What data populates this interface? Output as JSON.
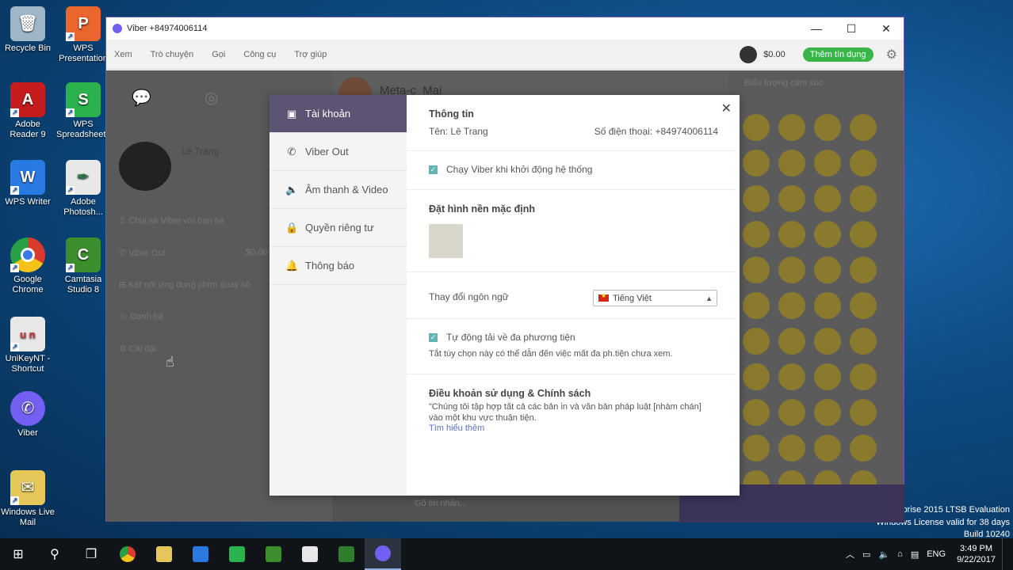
{
  "desktop": {
    "icons_left": [
      {
        "label": "Recycle Bin",
        "icon": "recycle-bin-icon",
        "color": "#9fb6c9"
      },
      {
        "label": "Adobe Reader 9",
        "icon": "adobe-reader-icon",
        "color": "#c51d1d"
      },
      {
        "label": "WPS Writer",
        "icon": "wps-writer-icon",
        "color": "#2a7ae4"
      },
      {
        "label": "Google Chrome",
        "icon": "chrome-icon",
        "color": "#e6b91c"
      },
      {
        "label": "UniKeyNT - Shortcut",
        "icon": "unikey-icon",
        "color": "#e8e8e8"
      },
      {
        "label": "Viber",
        "icon": "viber-icon",
        "color": "#7360f2"
      },
      {
        "label": "Windows Live Mail",
        "icon": "live-mail-icon",
        "color": "#e6c85a"
      }
    ],
    "icons_right": [
      {
        "label": "WPS Presentation",
        "icon": "wps-presentation-icon",
        "color": "#e9662c"
      },
      {
        "label": "WPS Spreadsheets",
        "icon": "wps-spreadsheets-icon",
        "color": "#2bb24c"
      },
      {
        "label": "Adobe Photosh...",
        "icon": "photoshop-feather-icon",
        "color": "#e8e8e8"
      },
      {
        "label": "Camtasia Studio 8",
        "icon": "camtasia-icon",
        "color": "#3d8f2e"
      }
    ],
    "watermark": [
      "rprise 2015 LTSB Evaluation",
      "Windows License valid for 38 days",
      "Build 10240"
    ]
  },
  "window": {
    "title": "Viber +84974006114",
    "menu": [
      "Xem",
      "Trò chuyện",
      "Gọi",
      "Công cụ",
      "Trợ giúp"
    ],
    "credit": "$0.00",
    "buy_credit": "Thêm tín dụng",
    "chat_contact": "Meta-c_Mai",
    "left_profile_name": "Lê Trang",
    "left_rows": [
      "Chia sẻ Viber với bạn bè",
      "Viber Out",
      "Kết nối ứng dụng phím quay số",
      "Danh bạ",
      "Cài đặt"
    ],
    "left_credit": "$0.00",
    "composer_placeholder": "Gõ tin nhắn...",
    "sticker_search": "Biểu tượng cảm xúc"
  },
  "settings": {
    "nav": [
      {
        "label": "Tài khoản",
        "icon": "account-card-icon"
      },
      {
        "label": "Viber Out",
        "icon": "phone-icon"
      },
      {
        "label": "Âm thanh & Video",
        "icon": "speaker-icon"
      },
      {
        "label": "Quyền riêng tư",
        "icon": "lock-icon"
      },
      {
        "label": "Thông báo",
        "icon": "bell-icon"
      }
    ],
    "info_title": "Thông tin",
    "name_text": "Tên: Lê Trang",
    "phone_text": "Số điện thoại: +84974006114",
    "startup_label": "Chạy Viber khi khởi động hệ thống",
    "startup_checked": true,
    "bg_title": "Đặt hình nền mặc định",
    "language_label": "Thay đổi ngôn ngữ",
    "language_value": "Tiếng Việt",
    "autodownload_label": "Tự động tải về đa phương tiện",
    "autodownload_checked": true,
    "autodownload_note": "Tắt tùy chọn này có thể dẫn đến việc mất đa ph.tiện chưa xem.",
    "terms_title": "Điều khoản sử dụng & Chính sách",
    "terms_text_1": "\"Chúng tôi tập hợp tất cả các bản in và văn bản pháp luật [nhàm chán]",
    "terms_text_2": "vào một khu vực thuận tiện.",
    "terms_link": "Tìm hiểu thêm"
  },
  "taskbar": {
    "lang": "ENG",
    "time": "3:49 PM",
    "date": "9/22/2017"
  },
  "colors": {
    "viber_purple": "#7360f2",
    "nav_active": "#5d5474",
    "buy_green": "#3bb44a",
    "checkbox": "#5fb6b6"
  }
}
